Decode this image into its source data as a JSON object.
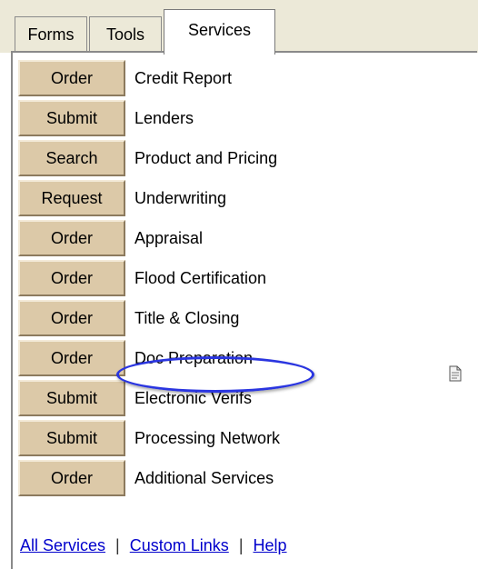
{
  "tabs": {
    "forms": "Forms",
    "tools": "Tools",
    "services": "Services",
    "active": "Services"
  },
  "services": [
    {
      "button": "Order",
      "label": "Credit Report"
    },
    {
      "button": "Submit",
      "label": "Lenders"
    },
    {
      "button": "Search",
      "label": "Product and Pricing"
    },
    {
      "button": "Request",
      "label": "Underwriting"
    },
    {
      "button": "Order",
      "label": "Appraisal"
    },
    {
      "button": "Order",
      "label": "Flood Certification"
    },
    {
      "button": "Order",
      "label": "Title & Closing"
    },
    {
      "button": "Order",
      "label": "Doc Preparation",
      "highlighted": true
    },
    {
      "button": "Submit",
      "label": "Electronic Verifs"
    },
    {
      "button": "Submit",
      "label": "Processing Network"
    },
    {
      "button": "Order",
      "label": "Additional Services"
    }
  ],
  "links": {
    "all_services": "All Services",
    "custom_links": "Custom Links",
    "help": "Help",
    "separator": "|"
  },
  "colors": {
    "button_bg": "#dcc9a8",
    "highlight": "#2a35e0",
    "link": "#0000cc"
  }
}
